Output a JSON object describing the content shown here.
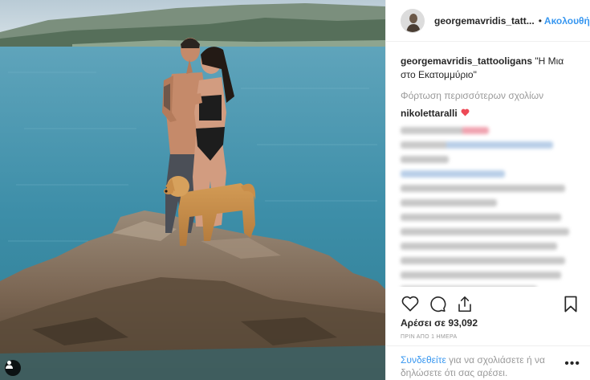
{
  "post": {
    "username": "georgemavridis_tatt...",
    "header_separator": "•",
    "follow_label": "Ακολουθήστε",
    "caption_user": "georgemavridis_tattooligans",
    "caption_text": " \"Η Μια στο Εκατομμύριο\"",
    "load_more": "Φόρτωση περισσότερων σχολίων",
    "comment_user": "nikolettaralli",
    "likes": "Αρέσει σε 93,092",
    "time": "ΠΡΙΝ ΑΠΟ 1 ΗΜΕΡΑ",
    "login_link": "Συνδεθείτε",
    "login_text": " για να σχολιάσετε ή να δηλώσετε ότι σας αρέσει.",
    "more_options": "•••"
  },
  "icons": {
    "like": "heart-outline-icon",
    "comment": "comment-bubble-icon",
    "share": "share-upload-icon",
    "save": "bookmark-icon",
    "comment_heart": "heart-filled-icon",
    "user_tag": "user-tag-icon"
  },
  "colors": {
    "link_blue": "#3897f0",
    "heart_red": "#ed4956",
    "muted_gray": "#999999",
    "text": "#262626"
  }
}
